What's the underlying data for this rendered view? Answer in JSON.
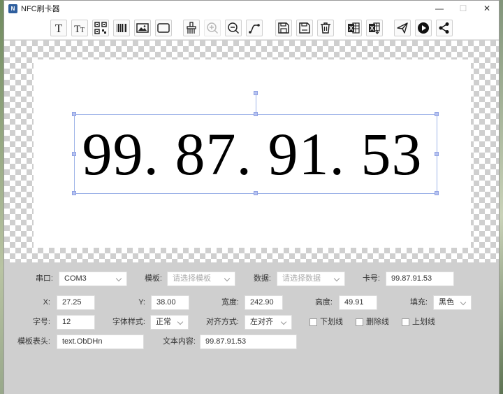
{
  "window": {
    "title": "NFC刷卡器",
    "min": "—",
    "max": "☐",
    "close": "✕"
  },
  "toolbar": {
    "buttons": [
      {
        "icon": "text-icon"
      },
      {
        "icon": "text-size-icon"
      },
      {
        "icon": "qr-code-icon"
      },
      {
        "icon": "barcode-icon"
      },
      {
        "icon": "image-icon"
      },
      {
        "icon": "rectangle-icon"
      },
      {
        "icon": "clear-icon"
      },
      {
        "icon": "zoom-in-icon"
      },
      {
        "icon": "zoom-out-icon"
      },
      {
        "icon": "curve-icon"
      },
      {
        "icon": "save-icon"
      },
      {
        "icon": "save-as-icon"
      },
      {
        "icon": "delete-icon"
      },
      {
        "icon": "excel-import-icon"
      },
      {
        "icon": "excel-export-icon"
      },
      {
        "icon": "send-icon"
      },
      {
        "icon": "play-icon"
      },
      {
        "icon": "share-icon"
      }
    ]
  },
  "canvas": {
    "card_text": "99. 87. 91. 53"
  },
  "form": {
    "serial_label": "串口:",
    "serial_value": "COM3",
    "template_label": "模板:",
    "template_placeholder": "请选择模板",
    "data_label": "数据:",
    "data_placeholder": "请选择数据",
    "card_no_label": "卡号:",
    "card_no_value": "99.87.91.53",
    "x_label": "X:",
    "x_value": "27.25",
    "y_label": "Y:",
    "y_value": "38.00",
    "width_label": "宽度:",
    "width_value": "242.90",
    "height_label": "高度:",
    "height_value": "49.91",
    "fill_label": "填充:",
    "fill_value": "黑色",
    "font_size_label": "字号:",
    "font_size_value": "12",
    "font_style_label": "字体样式:",
    "font_style_value": "正常",
    "align_label": "对齐方式:",
    "align_value": "左对齐",
    "underline_label": "下划线",
    "strikethrough_label": "删除线",
    "overline_label": "上划线",
    "template_header_label": "模板表头:",
    "template_header_value": "text.ObDHn",
    "text_content_label": "文本内容:",
    "text_content_value": "99.87.91.53"
  }
}
